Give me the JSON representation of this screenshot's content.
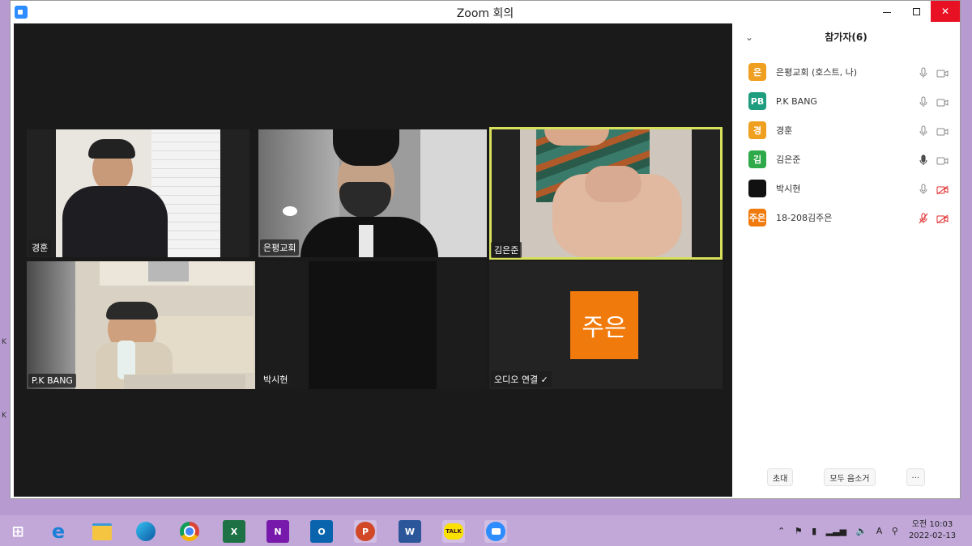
{
  "window": {
    "title": "Zoom 회의"
  },
  "tiles": [
    {
      "name": "경훈"
    },
    {
      "name": "은평교회"
    },
    {
      "name": "김은준"
    },
    {
      "name": "P.K BANG"
    },
    {
      "name": "박시현"
    },
    {
      "name": "오디오 연결 ✓",
      "avatar_text": "주은",
      "avatar_color": "#f07a0c"
    }
  ],
  "participants_panel": {
    "title": "참가자(6)",
    "participants": [
      {
        "initials": "은",
        "name": "은평교회 (호스트, 나)",
        "color": "#f0a020",
        "mic": "on",
        "video": "on"
      },
      {
        "initials": "PB",
        "name": "P.K BANG",
        "color": "#1e9e7e",
        "mic": "on",
        "video": "on"
      },
      {
        "initials": "경",
        "name": "경훈",
        "color": "#f0a020",
        "mic": "on",
        "video": "on"
      },
      {
        "initials": "김",
        "name": "김은준",
        "color": "#2eaa4a",
        "mic": "active",
        "video": "on"
      },
      {
        "initials": "",
        "name": "박시현",
        "color": "#111111",
        "mic": "on",
        "video": "off"
      },
      {
        "initials": "주은",
        "name": "18-208김주은",
        "color": "#f07a0c",
        "mic": "off",
        "video": "off"
      }
    ],
    "buttons": {
      "invite": "초대",
      "mute_all": "모두 음소거",
      "more": "..."
    }
  },
  "taskbar": {
    "time": "오전 10:03",
    "date": "2022-02-13",
    "apps": [
      "windows-start",
      "internet-explorer",
      "file-explorer",
      "edge",
      "chrome",
      "excel",
      "onenote",
      "outlook",
      "powerpoint",
      "word",
      "kakaotalk",
      "zoom"
    ],
    "kakao_label": "TALK",
    "ime": "A"
  },
  "edge_chars": [
    "K",
    "K"
  ]
}
